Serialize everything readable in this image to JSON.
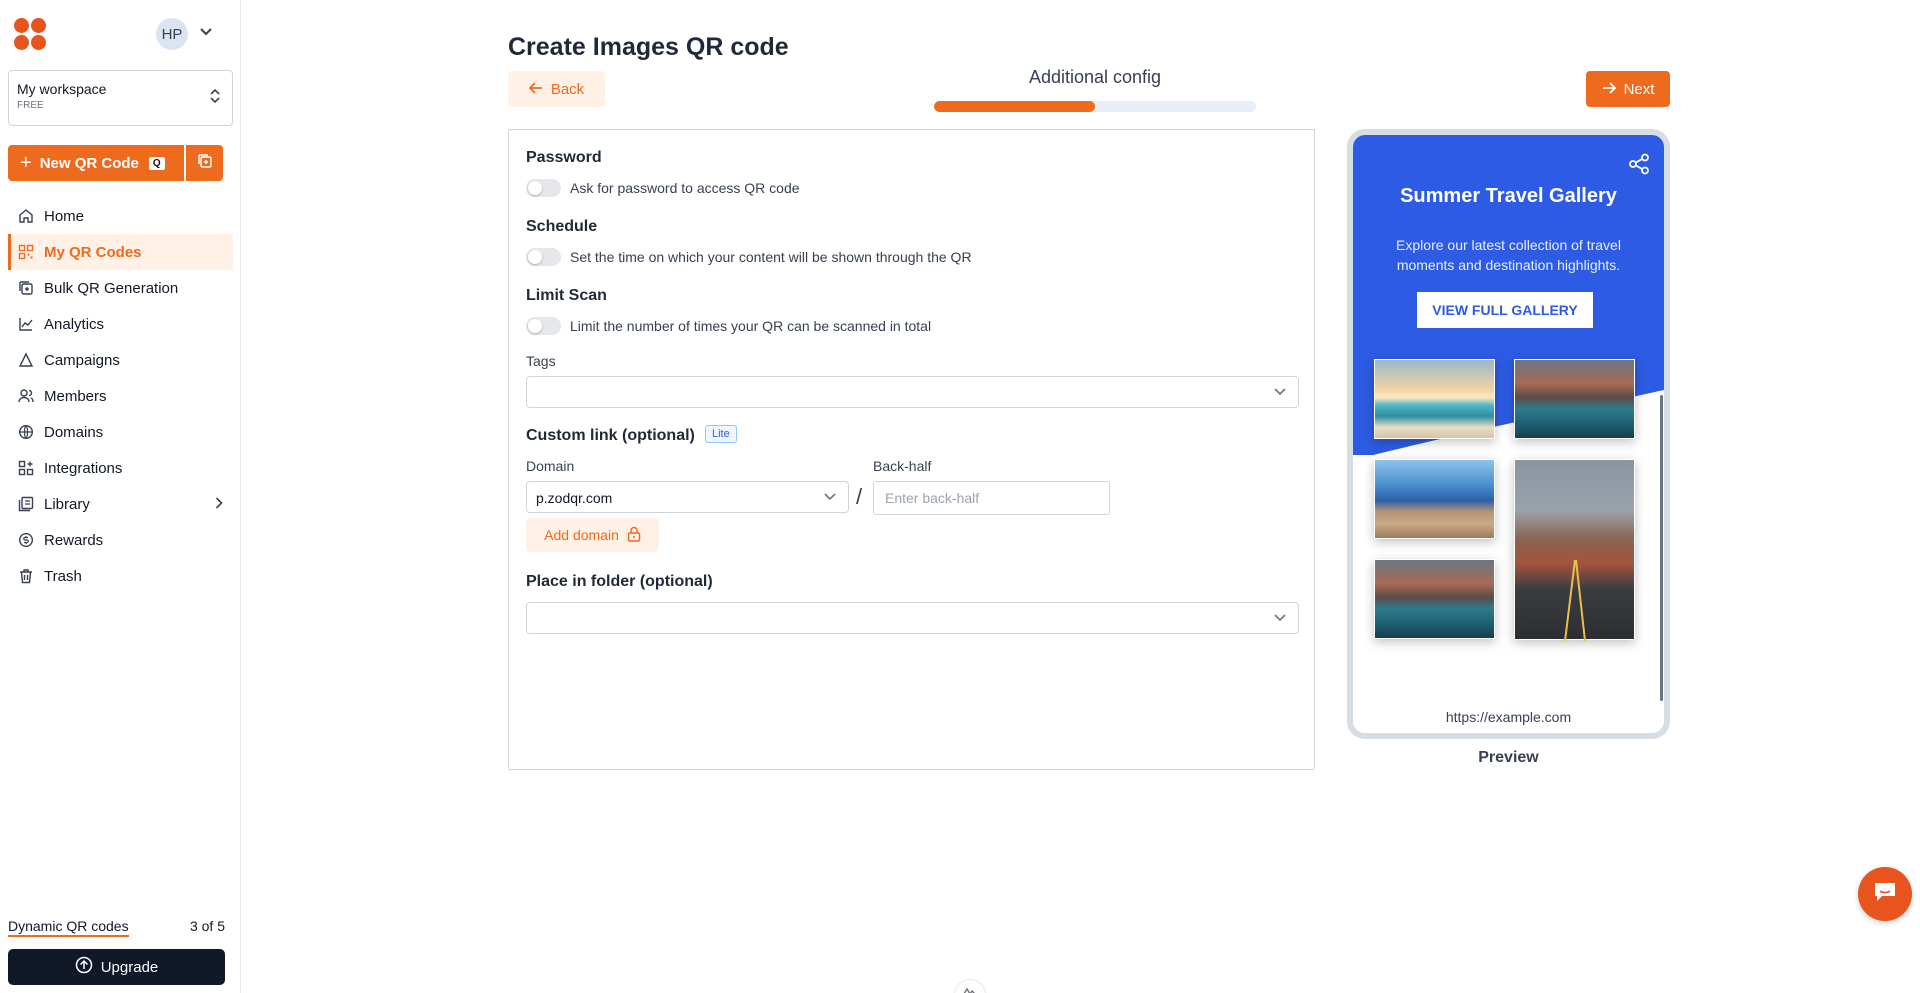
{
  "app": {
    "avatar_initials": "HP",
    "accent_color": "#ee6a1f"
  },
  "workspace": {
    "name": "My workspace",
    "plan": "FREE"
  },
  "new_qr": {
    "label": "New QR Code",
    "shortcut": "Q"
  },
  "sidebar": {
    "items": [
      {
        "label": "Home",
        "icon": "home-icon"
      },
      {
        "label": "My QR Codes",
        "icon": "qr-grid-icon",
        "active": true
      },
      {
        "label": "Bulk QR Generation",
        "icon": "bulk-icon"
      },
      {
        "label": "Analytics",
        "icon": "chart-icon"
      },
      {
        "label": "Campaigns",
        "icon": "campaign-icon"
      },
      {
        "label": "Members",
        "icon": "members-icon"
      },
      {
        "label": "Domains",
        "icon": "globe-icon"
      },
      {
        "label": "Integrations",
        "icon": "integrations-icon"
      },
      {
        "label": "Library",
        "icon": "library-icon"
      },
      {
        "label": "Rewards",
        "icon": "rewards-icon"
      },
      {
        "label": "Trash",
        "icon": "trash-icon"
      }
    ],
    "usage_label": "Dynamic QR codes",
    "usage_count": "3 of 5",
    "upgrade_label": "Upgrade"
  },
  "header": {
    "title": "Create Images QR code",
    "back_label": "Back",
    "next_label": "Next",
    "step_title": "Additional config",
    "progress": 0.5
  },
  "form": {
    "password_title": "Password",
    "password_toggle": "Ask for password to access QR code",
    "schedule_title": "Schedule",
    "schedule_toggle": "Set the time on which your content will be shown through the QR",
    "limit_title": "Limit Scan",
    "limit_toggle": "Limit the number of times your QR can be scanned in total",
    "tags_label": "Tags",
    "custom_link_title": "Custom link (optional)",
    "lite_badge": "Lite",
    "domain_label": "Domain",
    "domain_value": "p.zodqr.com",
    "slash": "/",
    "backhalf_label": "Back-half",
    "backhalf_placeholder": "Enter back-half",
    "add_domain_label": "Add domain",
    "folder_title": "Place in folder (optional)"
  },
  "preview": {
    "title": "Summer Travel Gallery",
    "description": "Explore our latest collection of travel moments and destination highlights.",
    "button": "VIEW FULL GALLERY",
    "url": "https://example.com",
    "label": "Preview",
    "brand_color": "#2d5be3"
  }
}
